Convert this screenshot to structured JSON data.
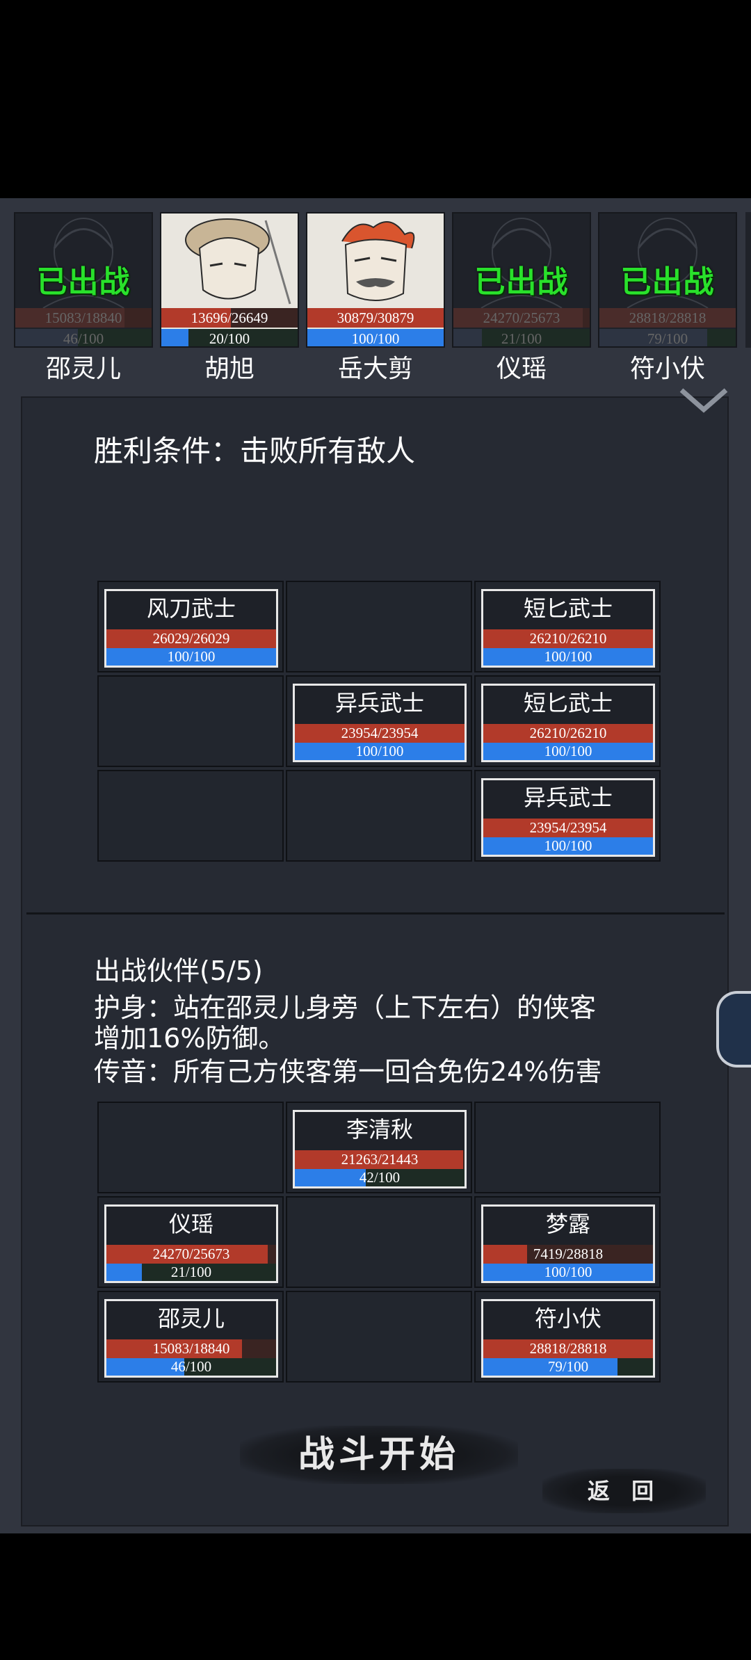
{
  "roster": [
    {
      "name": "邵灵儿",
      "hp": "15083/18840",
      "hp_pct": 0.8,
      "mp": "46/100",
      "mp_pct": 0.46,
      "deployed": true,
      "badge": "已出战"
    },
    {
      "name": "胡旭",
      "hp": "13696/26649",
      "hp_pct": 0.51,
      "mp": "20/100",
      "mp_pct": 0.2,
      "deployed": false,
      "badge": ""
    },
    {
      "name": "岳大剪",
      "hp": "30879/30879",
      "hp_pct": 1.0,
      "mp": "100/100",
      "mp_pct": 1.0,
      "deployed": false,
      "badge": ""
    },
    {
      "name": "仪瑶",
      "hp": "24270/25673",
      "hp_pct": 0.95,
      "mp": "21/100",
      "mp_pct": 0.21,
      "deployed": true,
      "badge": "已出战"
    },
    {
      "name": "符小伏",
      "hp": "28818/28818",
      "hp_pct": 1.0,
      "mp": "79/100",
      "mp_pct": 0.79,
      "deployed": true,
      "badge": "已出战"
    }
  ],
  "victory_condition": "胜利条件：击败所有敌人",
  "enemies": [
    {
      "row": 0,
      "col": 0,
      "name": "风刀武士",
      "hp": "26029/26029",
      "hp_pct": 1.0,
      "mp": "100/100",
      "mp_pct": 1.0
    },
    {
      "row": 0,
      "col": 2,
      "name": "短匕武士",
      "hp": "26210/26210",
      "hp_pct": 1.0,
      "mp": "100/100",
      "mp_pct": 1.0
    },
    {
      "row": 1,
      "col": 1,
      "name": "异兵武士",
      "hp": "23954/23954",
      "hp_pct": 1.0,
      "mp": "100/100",
      "mp_pct": 1.0
    },
    {
      "row": 1,
      "col": 2,
      "name": "短匕武士",
      "hp": "26210/26210",
      "hp_pct": 1.0,
      "mp": "100/100",
      "mp_pct": 1.0
    },
    {
      "row": 2,
      "col": 2,
      "name": "异兵武士",
      "hp": "23954/23954",
      "hp_pct": 1.0,
      "mp": "100/100",
      "mp_pct": 1.0
    }
  ],
  "partners_title": "出战伙伴(5/5)",
  "skills": [
    "护身：站在邵灵儿身旁（上下左右）的侠客",
    "增加16%防御。",
    "传音：所有己方侠客第一回合免伤24%伤害"
  ],
  "allies": [
    {
      "row": 0,
      "col": 1,
      "name": "李清秋",
      "hp": "21263/21443",
      "hp_pct": 0.99,
      "mp": "42/100",
      "mp_pct": 0.42
    },
    {
      "row": 1,
      "col": 0,
      "name": "仪瑶",
      "hp": "24270/25673",
      "hp_pct": 0.95,
      "mp": "21/100",
      "mp_pct": 0.21
    },
    {
      "row": 1,
      "col": 2,
      "name": "梦露",
      "hp": "7419/28818",
      "hp_pct": 0.26,
      "mp": "100/100",
      "mp_pct": 1.0
    },
    {
      "row": 2,
      "col": 0,
      "name": "邵灵儿",
      "hp": "15083/18840",
      "hp_pct": 0.8,
      "mp": "46/100",
      "mp_pct": 0.46
    },
    {
      "row": 2,
      "col": 2,
      "name": "符小伏",
      "hp": "28818/28818",
      "hp_pct": 1.0,
      "mp": "79/100",
      "mp_pct": 0.79
    }
  ],
  "start_button": "战斗开始",
  "back_button": "返 回",
  "colors": {
    "deployed_green": "#29e12b",
    "hp_red": "#b23a2a",
    "mp_blue": "#2c7ee8"
  }
}
